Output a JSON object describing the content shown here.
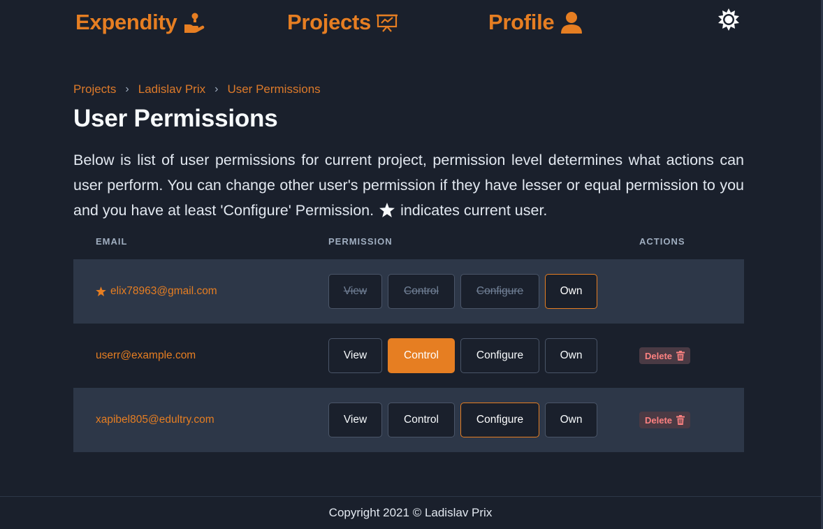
{
  "nav": {
    "brand": "Expendity",
    "brand_icon": "hand-coin-icon",
    "projects": "Projects",
    "projects_icon": "presentation-chart-icon",
    "profile": "Profile",
    "profile_icon": "user-icon",
    "theme_icon": "sun-icon"
  },
  "breadcrumb": {
    "items": [
      "Projects",
      "Ladislav Prix",
      "User Permissions"
    ],
    "separator": "›"
  },
  "page": {
    "title": "User Permissions",
    "intro_before_star": "Below is list of user permissions for current project, permission level determines what actions can user perform. You can change other user's permission if they have lesser or equal permission to you and you have at least 'Configure' Permission.",
    "intro_after_star": "indicates current user."
  },
  "table": {
    "headers": {
      "email": "EMAIL",
      "permission": "PERMISSION",
      "actions": "ACTIONS"
    },
    "permission_levels": [
      "View",
      "Control",
      "Configure",
      "Own"
    ],
    "rows": [
      {
        "email": "elix78963@gmail.com",
        "is_current_user": true,
        "permission": "Own",
        "actions": []
      },
      {
        "email": "userr@example.com",
        "is_current_user": false,
        "permission": "Control",
        "actions": [
          "Delete"
        ]
      },
      {
        "email": "xapibel805@edultry.com",
        "is_current_user": false,
        "permission": "Configure",
        "actions": [
          "Delete"
        ]
      }
    ],
    "delete_label": "Delete"
  },
  "footer": {
    "text": "Copyright 2021 © Ladislav Prix"
  },
  "colors": {
    "background": "#1a202c",
    "accent": "#e67e22",
    "row_alt": "#2d3748",
    "delete_text": "#fc8181"
  }
}
